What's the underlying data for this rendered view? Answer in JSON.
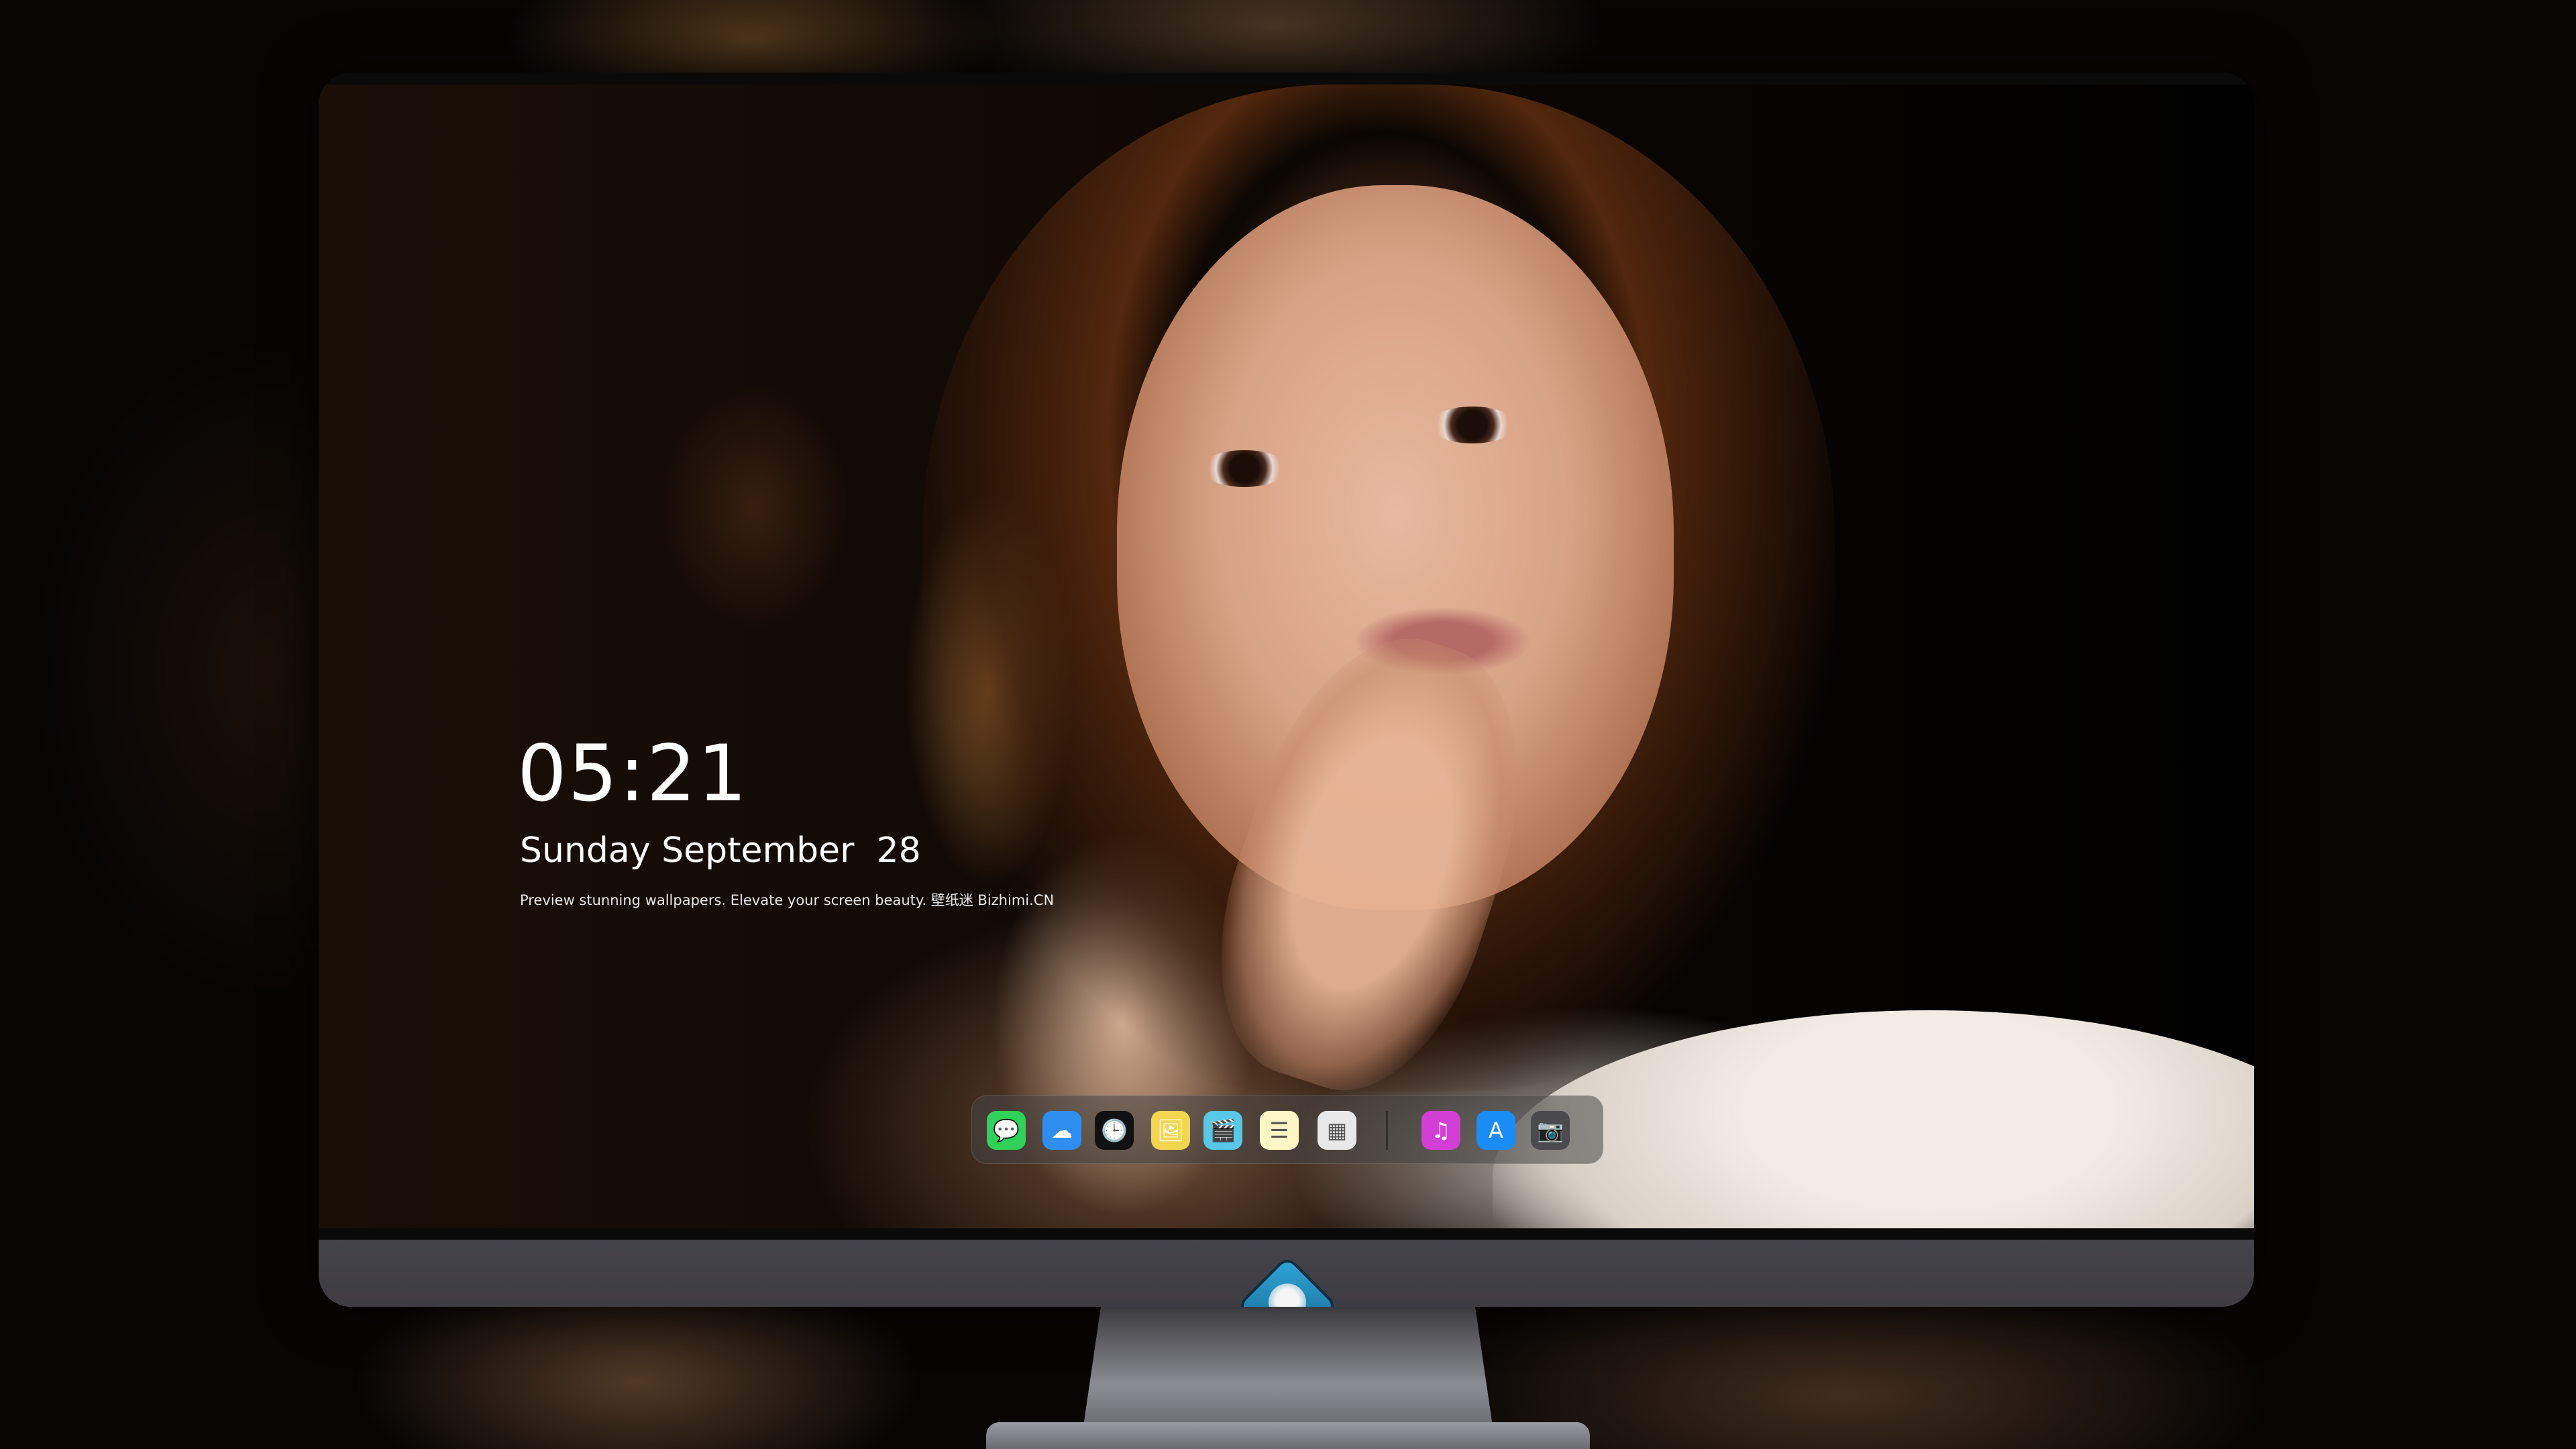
{
  "lockscreen": {
    "time": "05:21",
    "date": "Sunday September  28",
    "tagline": "Preview stunning wallpapers. Elevate your screen beauty. 壁纸迷 Bizhimi.CN"
  },
  "dock": {
    "apps": [
      {
        "name": "Messages",
        "icon": "messages-icon",
        "color": "#2fd158",
        "glyph": "💬"
      },
      {
        "name": "Weather",
        "icon": "weather-icon",
        "color": "#2f8ff0",
        "glyph": "☁"
      },
      {
        "name": "Clock",
        "icon": "clock-icon",
        "color": "#111111",
        "glyph": "🕒"
      },
      {
        "name": "Preview",
        "icon": "preview-icon",
        "color": "#f2d64f",
        "glyph": "🖼"
      },
      {
        "name": "Clips",
        "icon": "clips-icon",
        "color": "#58c7e8",
        "glyph": "🎬"
      },
      {
        "name": "Notes",
        "icon": "notes-icon",
        "color": "#fff6c6",
        "glyph": "☰"
      },
      {
        "name": "Photo Booth",
        "icon": "photo-booth-icon",
        "color": "#e8e8e8",
        "glyph": "▦"
      },
      {
        "name": "Music",
        "icon": "music-icon",
        "color": "#d33fd6",
        "glyph": "♫"
      },
      {
        "name": "App Store",
        "icon": "app-store-icon",
        "color": "#1a8cf5",
        "glyph": "A"
      },
      {
        "name": "Camera",
        "icon": "camera-icon",
        "color": "#4a4a4f",
        "glyph": "📷"
      }
    ]
  }
}
